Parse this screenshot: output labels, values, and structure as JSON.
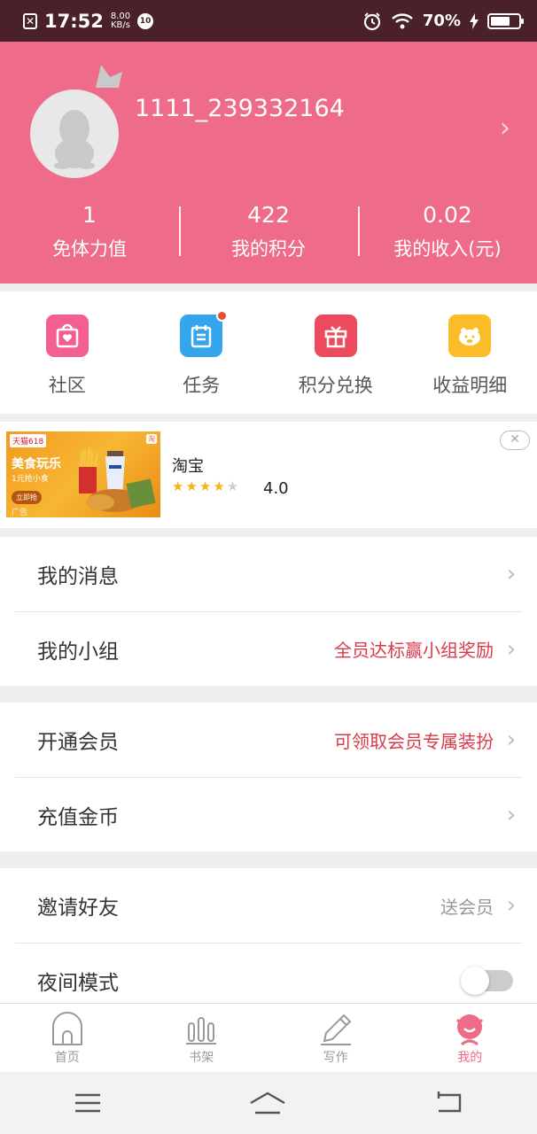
{
  "status_bar": {
    "time": "17:52",
    "speed_value": "8.00",
    "speed_unit": "KB/s",
    "badge": "10",
    "battery_percent": "70%",
    "battery_level": 0.7
  },
  "profile": {
    "username": "1111_239332164",
    "stats": [
      {
        "value": "1",
        "label": "免体力值"
      },
      {
        "value": "422",
        "label": "我的积分"
      },
      {
        "value": "0.02",
        "label": "我的收入(元)"
      }
    ]
  },
  "grid": [
    {
      "label": "社区",
      "icon": "heart-bag-icon",
      "color": "#f45f93"
    },
    {
      "label": "任务",
      "icon": "clipboard-icon",
      "color": "#34a6ee"
    },
    {
      "label": "积分兑换",
      "icon": "gift-icon",
      "color": "#ee4a5d"
    },
    {
      "label": "收益明细",
      "icon": "piggy-bank-icon",
      "color": "#fbbd27"
    }
  ],
  "ad": {
    "title": "淘宝",
    "rating": "4.0",
    "rating_value": 4,
    "image_brand": "天猫618",
    "image_tag": "淘",
    "image_headline": "美食玩乐",
    "image_sub": "1元抢小食",
    "image_button": "立即抢",
    "image_label": "广告",
    "close_symbol": "✕"
  },
  "menu": {
    "section1": [
      {
        "title": "我的消息",
        "extra": ""
      },
      {
        "title": "我的小组",
        "extra": "全员达标赢小组奖励"
      }
    ],
    "section2": [
      {
        "title": "开通会员",
        "extra": "可领取会员专属装扮"
      },
      {
        "title": "充值金币",
        "extra": ""
      }
    ],
    "section3": [
      {
        "title": "邀请好友",
        "extra": "送会员"
      },
      {
        "title": "夜间模式",
        "toggle_on": false
      }
    ]
  },
  "tabs": [
    {
      "label": "首页",
      "icon": "home-icon"
    },
    {
      "label": "书架",
      "icon": "bookshelf-icon"
    },
    {
      "label": "写作",
      "icon": "pencil-icon"
    },
    {
      "label": "我的",
      "icon": "profile-icon",
      "active": true
    }
  ],
  "colors": {
    "brand": "#ee6c89",
    "status_bar": "#4a2029",
    "accent_red": "#d93a4a"
  }
}
